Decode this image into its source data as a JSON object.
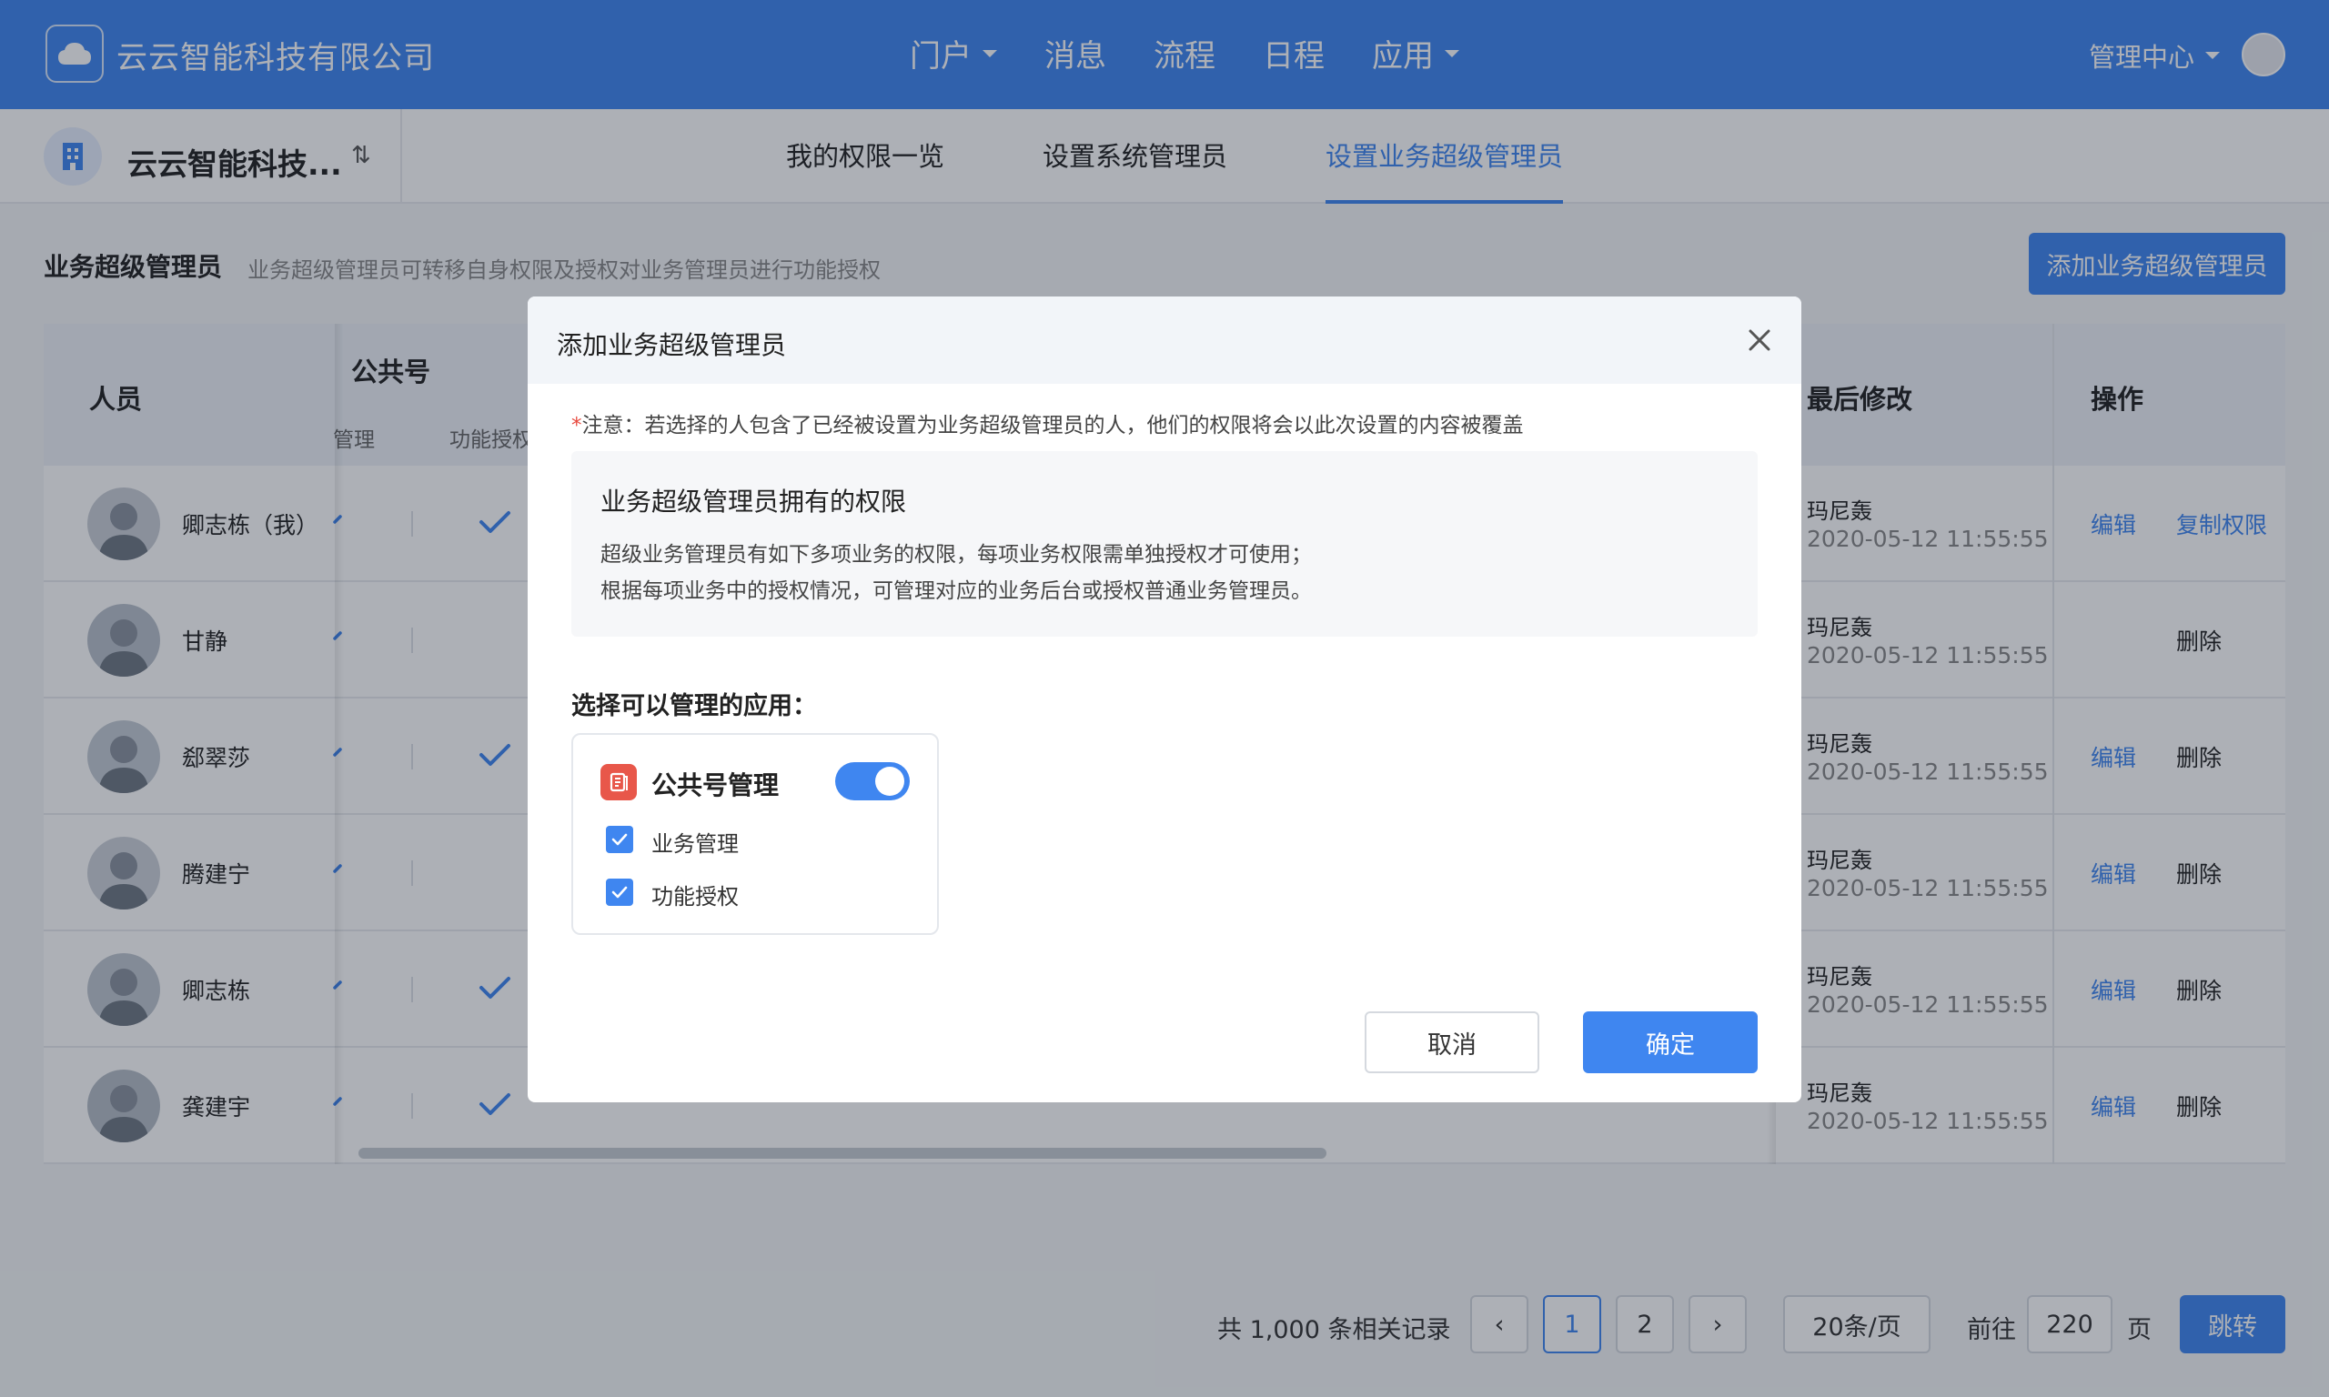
{
  "header": {
    "company": "云云智能科技有限公司",
    "nav": [
      {
        "label": "门户",
        "dropdown": true
      },
      {
        "label": "消息",
        "dropdown": false
      },
      {
        "label": "流程",
        "dropdown": false
      },
      {
        "label": "日程",
        "dropdown": false
      },
      {
        "label": "应用",
        "dropdown": true
      }
    ],
    "admin": "管理中心"
  },
  "subbar": {
    "org_name": "云云智能科技...",
    "switch_glyph": "⇅",
    "tabs": [
      "我的权限一览",
      "设置系统管理员",
      "设置业务超级管理员"
    ],
    "active_tab": 2
  },
  "section": {
    "title": "业务超级管理员",
    "desc": "业务超级管理员可转移自身权限及授权对业务管理员进行功能授权",
    "add_button": "添加业务超级管理员"
  },
  "table": {
    "headers": {
      "person": "人员",
      "group": "公共号",
      "sub1": "管理",
      "sub2": "功能授权",
      "last_modified": "最后修改",
      "operation": "操作"
    },
    "rows": [
      {
        "name": "卿志栋（我）",
        "modifier": "玛尼轰",
        "time": "2020-05-12 11:55:55",
        "op1": "编辑",
        "op2": "复制权限",
        "check": true
      },
      {
        "name": "甘静",
        "modifier": "玛尼轰",
        "time": "2020-05-12 11:55:55",
        "op1": "",
        "op2": "删除",
        "check": false
      },
      {
        "name": "郄翠莎",
        "modifier": "玛尼轰",
        "time": "2020-05-12 11:55:55",
        "op1": "编辑",
        "op2": "删除",
        "check": true
      },
      {
        "name": "腾建宁",
        "modifier": "玛尼轰",
        "time": "2020-05-12 11:55:55",
        "op1": "编辑",
        "op2": "删除",
        "check": false
      },
      {
        "name": "卿志栋",
        "modifier": "玛尼轰",
        "time": "2020-05-12 11:55:55",
        "op1": "编辑",
        "op2": "删除",
        "check": true
      },
      {
        "name": "龚建宇",
        "modifier": "玛尼轰",
        "time": "2020-05-12 11:55:55",
        "op1": "编辑",
        "op2": "删除",
        "check": true
      }
    ]
  },
  "pagination": {
    "total": "共 1,000 条相关记录",
    "prev": "‹",
    "pages": [
      "1",
      "2"
    ],
    "next": "›",
    "page_size": "20条/页",
    "goto": "前往",
    "goto_value": "220",
    "page_unit": "页",
    "jump": "跳转"
  },
  "modal": {
    "title": "添加业务超级管理员",
    "notice_star": "*",
    "notice": "注意：若选择的人包含了已经被设置为业务超级管理员的人，他们的权限将会以此次设置的内容被覆盖",
    "perm_title": "业务超级管理员拥有的权限",
    "perm_line1": "超级业务管理员有如下多项业务的权限，每项业务权限需单独授权才可使用；",
    "perm_line2": "根据每项业务中的授权情况，可管理对应的业务后台或授权普通业务管理员。",
    "choose_label": "选择可以管理的应用：",
    "app": {
      "name": "公共号管理",
      "enabled": true,
      "options": [
        {
          "label": "业务管理",
          "checked": true
        },
        {
          "label": "功能授权",
          "checked": true
        }
      ]
    },
    "cancel": "取消",
    "confirm": "确定"
  },
  "colors": {
    "primary": "#3f86f0",
    "danger_star": "#e84a3f",
    "app_icon": "#e8574a"
  }
}
